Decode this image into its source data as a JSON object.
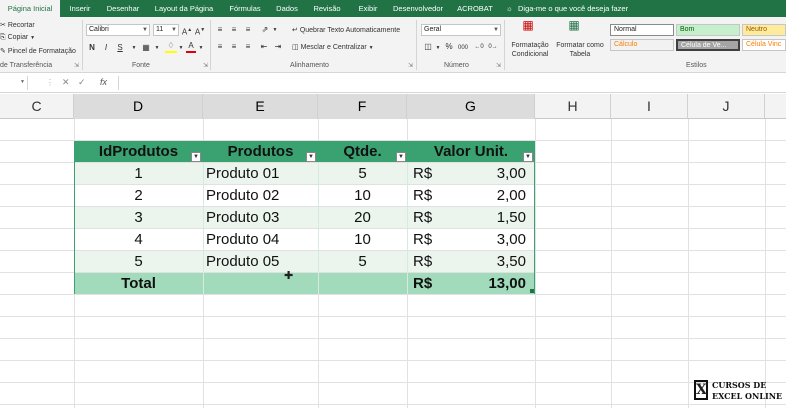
{
  "tabs": [
    "Página Inicial",
    "Inserir",
    "Desenhar",
    "Layout da Página",
    "Fórmulas",
    "Dados",
    "Revisão",
    "Exibir",
    "Desenvolvedor",
    "ACROBAT"
  ],
  "tell_me": "Diga-me o que você deseja fazer",
  "ribbon": {
    "clipboard": {
      "cut": "Recortar",
      "copy": "Copiar",
      "format_painter": "Pincel de Formatação",
      "label": "de Transferência"
    },
    "font": {
      "name": "Calibri",
      "size": "11",
      "label": "Fonte",
      "bold": "N",
      "italic": "I",
      "underline": "S"
    },
    "alignment": {
      "wrap": "Quebrar Texto Automaticamente",
      "merge": "Mesclar e Centralizar",
      "label": "Alinhamento"
    },
    "number": {
      "format": "Geral",
      "label": "Número",
      "pct": "%",
      "thousands": "000"
    },
    "styles": {
      "conditional": "Formatação Condicional",
      "as_table": "Formatar como Tabela",
      "label": "Estilos",
      "cells": [
        "Normal",
        "Bom",
        "Neutro",
        "Cálculo",
        "Célula de Ve...",
        "Célula Vinc"
      ]
    }
  },
  "formula_bar": {
    "fx": "fx",
    "name_box": "",
    "content": ""
  },
  "columns": [
    "C",
    "D",
    "E",
    "F",
    "G",
    "H",
    "I",
    "J"
  ],
  "table": {
    "headers": [
      "IdProdutos",
      "Produtos",
      "Qtde.",
      "Valor Unit."
    ],
    "rows": [
      {
        "id": "1",
        "produto": "Produto 01",
        "qtde": "5",
        "cur": "R$",
        "valor": "3,00"
      },
      {
        "id": "2",
        "produto": "Produto 02",
        "qtde": "10",
        "cur": "R$",
        "valor": "2,00"
      },
      {
        "id": "3",
        "produto": "Produto 03",
        "qtde": "20",
        "cur": "R$",
        "valor": "1,50"
      },
      {
        "id": "4",
        "produto": "Produto 04",
        "qtde": "10",
        "cur": "R$",
        "valor": "3,00"
      },
      {
        "id": "5",
        "produto": "Produto 05",
        "qtde": "5",
        "cur": "R$",
        "valor": "3,50"
      }
    ],
    "total": {
      "label": "Total",
      "cur": "R$",
      "valor": "13,00"
    }
  },
  "logo": {
    "line1": "CURSOS DE",
    "line2": "EXCEL ONLINE"
  },
  "colors": {
    "ribbon_green": "#217346",
    "header_green": "#3aa271",
    "band_light": "#ebf5ee",
    "total_green": "#a1dbbc"
  }
}
